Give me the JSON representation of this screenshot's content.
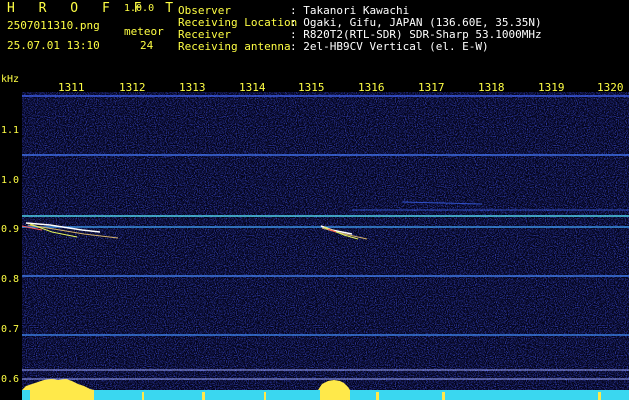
{
  "header": {
    "app_name": "H R O F F T",
    "version": "1.0.0",
    "filename": "2507011310.png",
    "datetime": "25.07.01 13:10",
    "meteor_label": "meteor",
    "meteor_count": "24",
    "fields": [
      {
        "label": "Observer",
        "value": ": Takanori Kawachi"
      },
      {
        "label": "Receiving Location",
        "value": ": Ogaki, Gifu, JAPAN (136.60E, 35.35N)"
      },
      {
        "label": "Receiver",
        "value": ": R820T2(RTL-SDR) SDR-Sharp 53.1000MHz"
      },
      {
        "label": "Receiving antenna",
        "value": ": 2el-HB9CV Vertical (el. E-W)"
      }
    ]
  },
  "axes": {
    "y_unit": "kHz",
    "y_ticks": [
      "1.1",
      "1.0",
      "0.9",
      "0.8",
      "0.7",
      "0.6"
    ],
    "x_ticks": [
      "1311",
      "1312",
      "1313",
      "1314",
      "1315",
      "1316",
      "1317",
      "1318",
      "1319",
      "1320"
    ]
  },
  "colors": {
    "background": "#000000",
    "label_yellow": "#ffff44",
    "header_white": "#ffffff",
    "noise_blue": "#1a1f8c",
    "line_cyan": "#4fd0e8",
    "activity_cyan": "#3ad7f0"
  }
}
